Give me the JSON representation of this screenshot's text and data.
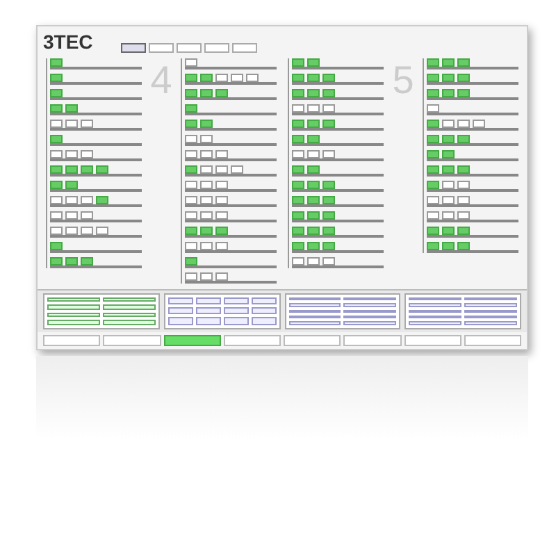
{
  "logo": "3TEC",
  "tabs": [
    {
      "selected": true
    },
    {
      "selected": false
    },
    {
      "selected": false
    },
    {
      "selected": false
    },
    {
      "selected": false
    }
  ],
  "sections": [
    {
      "number": "4",
      "columns": [
        {
          "rows": [
            [
              true
            ],
            [
              true
            ],
            [
              true
            ],
            [
              true,
              true
            ],
            [
              false,
              false,
              false
            ],
            [
              true
            ],
            [
              false,
              false,
              false
            ],
            [
              true,
              true,
              true,
              true
            ],
            [
              true,
              true
            ],
            [
              false,
              false,
              false,
              true
            ],
            [
              false,
              false,
              false
            ],
            [
              false,
              false,
              false,
              false
            ],
            [
              true
            ],
            [
              true,
              true,
              true
            ]
          ]
        },
        {
          "rows": [
            [
              false
            ],
            [
              true,
              true,
              false,
              false,
              false
            ],
            [
              true,
              true,
              true
            ],
            [
              true
            ],
            [
              true,
              true
            ],
            [
              false,
              false
            ],
            [
              false,
              false,
              false
            ],
            [
              true,
              false,
              false,
              false
            ],
            [
              false,
              false,
              false
            ],
            [
              false,
              false,
              false
            ],
            [
              false,
              false,
              false
            ],
            [
              true,
              true,
              true
            ],
            [
              false,
              false,
              false
            ],
            [
              true
            ],
            [
              false,
              false,
              false
            ]
          ]
        }
      ]
    },
    {
      "number": "5",
      "columns": [
        {
          "rows": [
            [
              true,
              true
            ],
            [
              true,
              true,
              true
            ],
            [
              true,
              true,
              true
            ],
            [
              false,
              false,
              false
            ],
            [
              true,
              true,
              true
            ],
            [
              true,
              true
            ],
            [
              false,
              false,
              false
            ],
            [
              true,
              true
            ],
            [
              true,
              true,
              true
            ],
            [
              true,
              true,
              true
            ],
            [
              true,
              true,
              true
            ],
            [
              true,
              true,
              true
            ],
            [
              true,
              true,
              true
            ],
            [
              false,
              false,
              false
            ]
          ]
        },
        {
          "rows": [
            [
              true,
              true,
              true
            ],
            [
              true,
              true,
              true
            ],
            [
              true,
              true,
              true
            ],
            [
              false
            ],
            [
              true,
              false,
              false,
              false
            ],
            [
              true,
              true,
              true
            ],
            [
              true,
              true
            ],
            [
              true,
              true,
              true
            ],
            [
              true,
              false,
              false
            ],
            [
              false,
              false,
              false
            ],
            [
              false,
              false,
              false
            ],
            [
              true,
              true,
              true
            ],
            [
              true,
              true,
              true
            ]
          ]
        }
      ]
    }
  ],
  "panels": [
    {
      "kind": "controls"
    },
    {
      "kind": "grid"
    },
    {
      "kind": "list"
    },
    {
      "kind": "list"
    }
  ],
  "buttons": [
    {
      "selected": false
    },
    {
      "selected": false
    },
    {
      "selected": true
    },
    {
      "selected": false
    },
    {
      "selected": false
    },
    {
      "selected": false
    },
    {
      "selected": false
    },
    {
      "selected": false
    }
  ]
}
